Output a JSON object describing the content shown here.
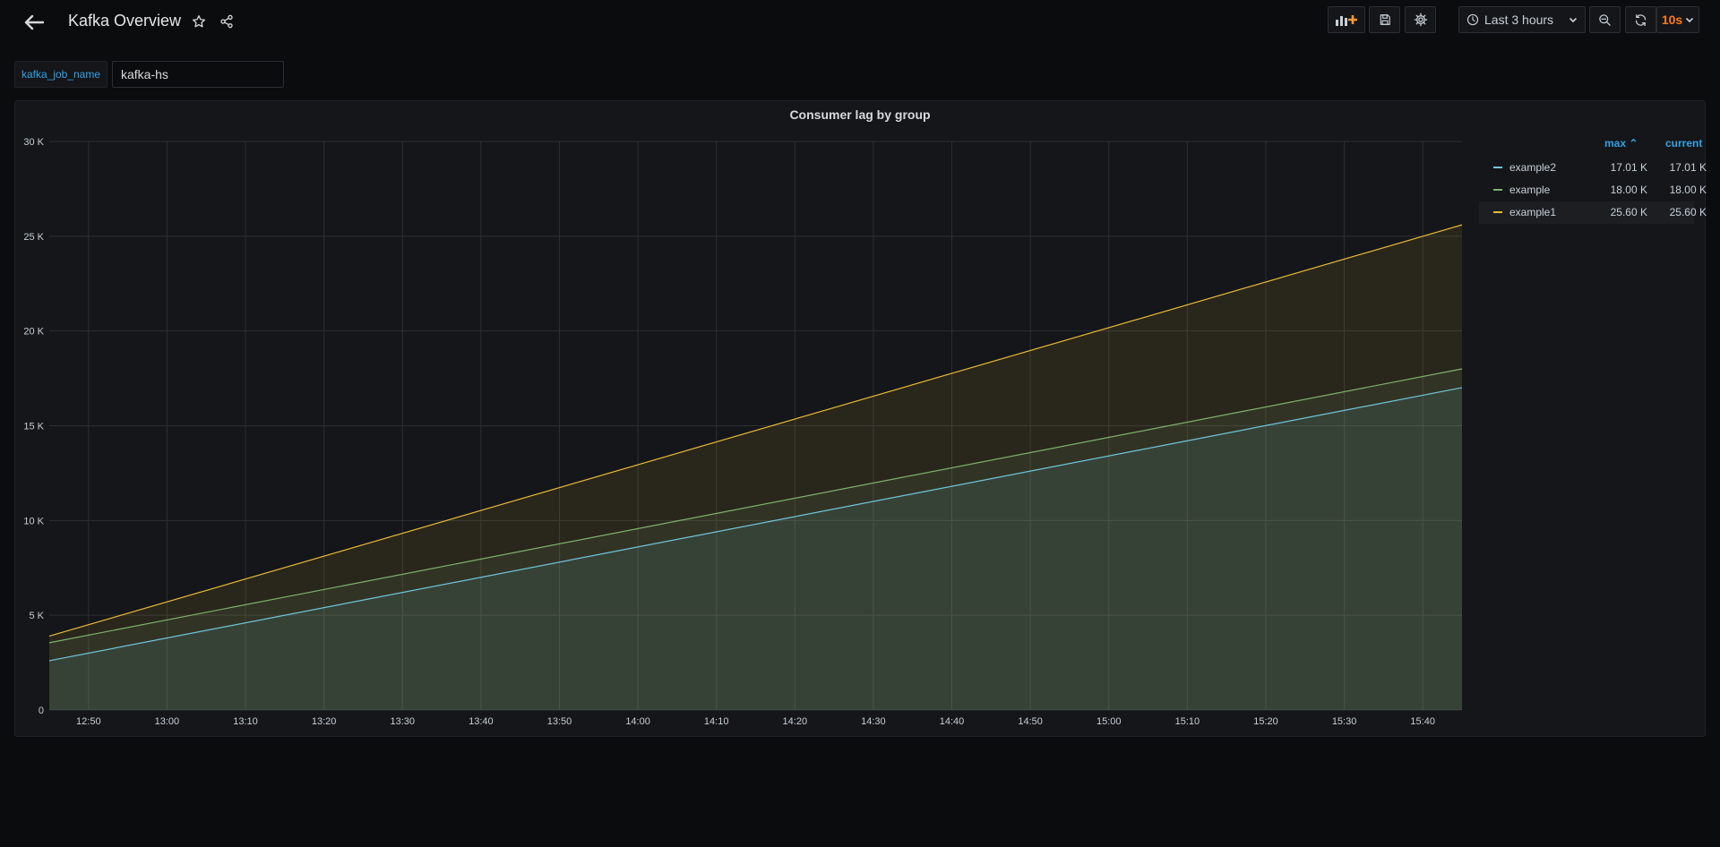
{
  "header": {
    "title": "Kafka Overview",
    "time_range": "Last 3 hours",
    "refresh_interval": "10s",
    "icons": [
      "arrow-left-icon",
      "star-icon",
      "share-icon",
      "add-panel-icon",
      "save-icon",
      "gear-icon",
      "clock-icon",
      "chevron-down-icon",
      "zoom-out-icon",
      "refresh-icon"
    ]
  },
  "variables": [
    {
      "label": "kafka_job_name",
      "value": "kafka-hs"
    }
  ],
  "panel": {
    "title": "Consumer lag by group"
  },
  "legend": {
    "columns": {
      "max": "max",
      "current": "current"
    },
    "items": [
      {
        "name": "example2",
        "max": "17.01 K",
        "current": "17.01 K",
        "color": "#70c6dc"
      },
      {
        "name": "example",
        "max": "18.00 K",
        "current": "18.00 K",
        "color": "#7eb26d"
      },
      {
        "name": "example1",
        "max": "25.60 K",
        "current": "25.60 K",
        "color": "#eab839"
      }
    ]
  },
  "chart_data": {
    "type": "area",
    "title": "Consumer lag by group",
    "x_ticks": [
      "12:50",
      "13:00",
      "13:10",
      "13:20",
      "13:30",
      "13:40",
      "13:50",
      "14:00",
      "14:10",
      "14:20",
      "14:30",
      "14:40",
      "14:50",
      "15:00",
      "15:10",
      "15:20",
      "15:30",
      "15:40"
    ],
    "x_range": [
      "12:45",
      "15:45"
    ],
    "y_ticks": [
      "0",
      "5 K",
      "10 K",
      "15 K",
      "20 K",
      "25 K",
      "30 K"
    ],
    "ylim": [
      0,
      30000
    ],
    "grid": true,
    "stacked": false,
    "legend_position": "right",
    "series": [
      {
        "name": "example1",
        "color": "#eab839",
        "x": [
          "12:45",
          "15:45"
        ],
        "values": [
          3900,
          25600
        ]
      },
      {
        "name": "example",
        "color": "#7eb26d",
        "x": [
          "12:45",
          "15:45"
        ],
        "values": [
          3550,
          18000
        ]
      },
      {
        "name": "example2",
        "color": "#70c6dc",
        "x": [
          "12:45",
          "15:45"
        ],
        "values": [
          2600,
          17010
        ]
      }
    ]
  }
}
